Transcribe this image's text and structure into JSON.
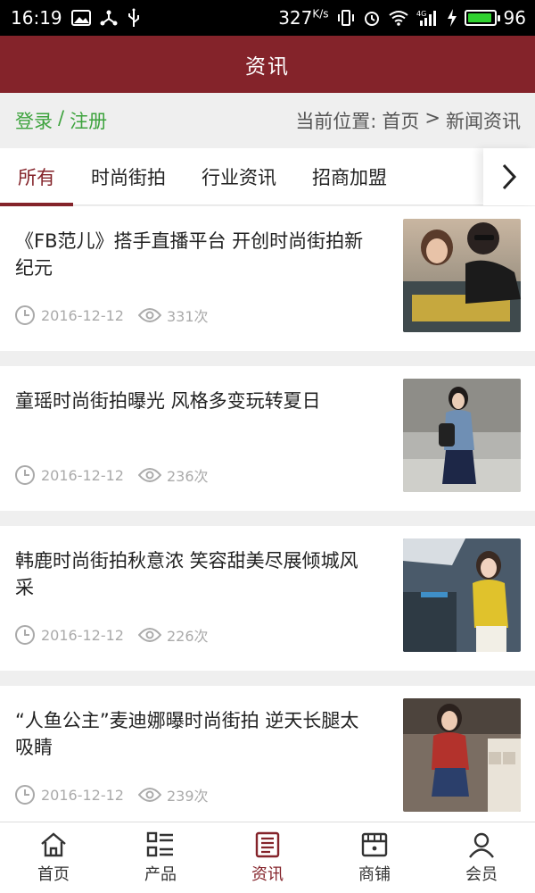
{
  "status": {
    "time": "16:19",
    "speed": "327",
    "speed_unit": "K/s",
    "battery": "96",
    "battery_level": 0.96,
    "battery_color": "#2fd12f"
  },
  "header": {
    "title": "资讯"
  },
  "location_bar": {
    "login": "登录",
    "separator": "/",
    "register": "注册",
    "current_label": "当前位置:",
    "home": "首页",
    "arrow": ">",
    "current": "新闻资讯"
  },
  "tabs": [
    {
      "label": "所有",
      "active": true
    },
    {
      "label": "时尚街拍",
      "active": false
    },
    {
      "label": "行业资讯",
      "active": false
    },
    {
      "label": "招商加盟",
      "active": false
    }
  ],
  "articles": [
    {
      "title": "《FB范儿》搭手直播平台 开创时尚街拍新纪元",
      "date": "2016-12-12",
      "views": "331次"
    },
    {
      "title": "童瑶时尚街拍曝光 风格多变玩转夏日",
      "date": "2016-12-12",
      "views": "236次"
    },
    {
      "title": "韩鹿时尚街拍秋意浓 笑容甜美尽展倾城风采",
      "date": "2016-12-12",
      "views": "226次"
    },
    {
      "title": "“人鱼公主”麦迪娜曝时尚街拍 逆天长腿太吸睛",
      "date": "2016-12-12",
      "views": "239次"
    }
  ],
  "bottom_nav": [
    {
      "label": "首页",
      "icon": "home-icon",
      "active": false
    },
    {
      "label": "产品",
      "icon": "list-icon",
      "active": false
    },
    {
      "label": "资讯",
      "icon": "news-icon",
      "active": true
    },
    {
      "label": "商铺",
      "icon": "shop-icon",
      "active": false
    },
    {
      "label": "会员",
      "icon": "user-icon",
      "active": false
    }
  ],
  "colors": {
    "brand": "#84232a",
    "login_green": "#3ea33e"
  }
}
